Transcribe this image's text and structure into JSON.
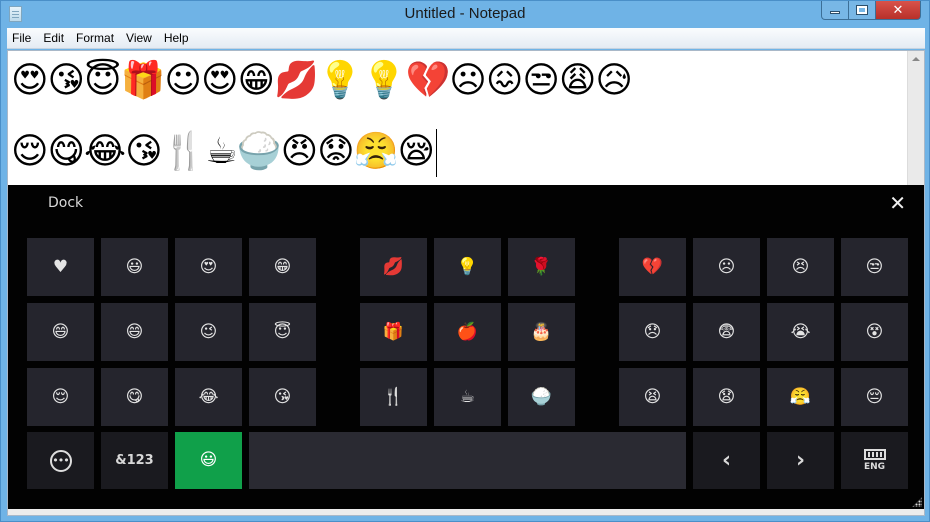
{
  "window": {
    "title": "Untitled - Notepad",
    "controls": {
      "minimize": "minimize",
      "maximize": "maximize",
      "close": "✕"
    }
  },
  "menubar": {
    "items": [
      "File",
      "Edit",
      "Format",
      "View",
      "Help"
    ]
  },
  "editor": {
    "line1": "😍😘😇🎁☺😍😁💋💡💡💔☹😖😒😩😥",
    "line2": "😌😋😂😘🍴☕🍚😠😟😤😪"
  },
  "keyboard": {
    "title": "Dock",
    "close_icon": "✕",
    "group1": [
      [
        "♥",
        "😃",
        "😍",
        "😁"
      ],
      [
        "😄",
        "😄",
        "😉",
        "😇"
      ],
      [
        "😌",
        "😋",
        "😂",
        "😘"
      ]
    ],
    "group2": [
      [
        "💋",
        "💡",
        "🌹"
      ],
      [
        "🎁",
        "🍎",
        "🎂"
      ],
      [
        "🍴",
        "☕",
        "🍚"
      ]
    ],
    "group3": [
      [
        "💔",
        "☹",
        "😣",
        "😒"
      ],
      [
        "😞",
        "😨",
        "😭",
        "😵"
      ],
      [
        "😫",
        "😧",
        "😤",
        "😔"
      ]
    ],
    "bottom": {
      "more_icon": "•••",
      "symbols_label": "&123",
      "emoji_key": "😃",
      "prev": "‹",
      "next": "›",
      "lang": "ENG"
    }
  },
  "colors": {
    "accent_green": "#10a04a",
    "key_bg": "#25252d",
    "keyboard_bg": "#020202",
    "titlebar": "#6fb3e6",
    "close_red": "#c9413a"
  }
}
